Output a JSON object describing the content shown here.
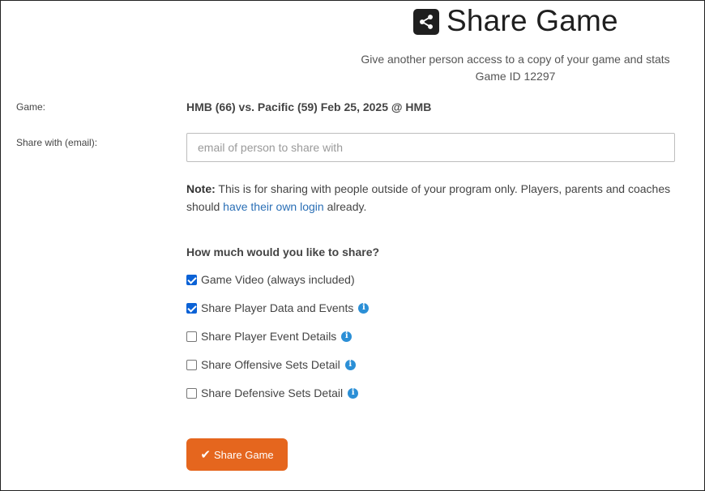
{
  "header": {
    "title": "Share Game",
    "subtitle_line1": "Give another person access to a copy of your game and stats",
    "subtitle_line2": "Game ID 12297"
  },
  "form": {
    "game_label": "Game:",
    "game_value": "HMB (66) vs. Pacific (59) Feb 25, 2025 @ HMB",
    "share_with_label": "Share with (email):",
    "email_placeholder": "email of person to share with",
    "email_value": ""
  },
  "note": {
    "bold": "Note:",
    "text_before_link": " This is for sharing with people outside of your program only. Players, parents and coaches should ",
    "link_text": "have their own login",
    "text_after_link": " already."
  },
  "share_options": {
    "question": "How much would you like to share?",
    "items": [
      {
        "label": "Game Video (always included)",
        "checked": true,
        "info": false
      },
      {
        "label": "Share Player Data and Events",
        "checked": true,
        "info": true
      },
      {
        "label": "Share Player Event Details",
        "checked": false,
        "info": true
      },
      {
        "label": "Share Offensive Sets Detail",
        "checked": false,
        "info": true
      },
      {
        "label": "Share Defensive Sets Detail",
        "checked": false,
        "info": true
      }
    ]
  },
  "actions": {
    "share_button_label": "Share Game"
  },
  "colors": {
    "button": "#e5661e",
    "link": "#2a6fb6",
    "info": "#2b8fd6",
    "checkbox": "#0b62d6"
  },
  "icons": {
    "header": "share-icon",
    "info": "info-icon",
    "button": "check-icon"
  }
}
